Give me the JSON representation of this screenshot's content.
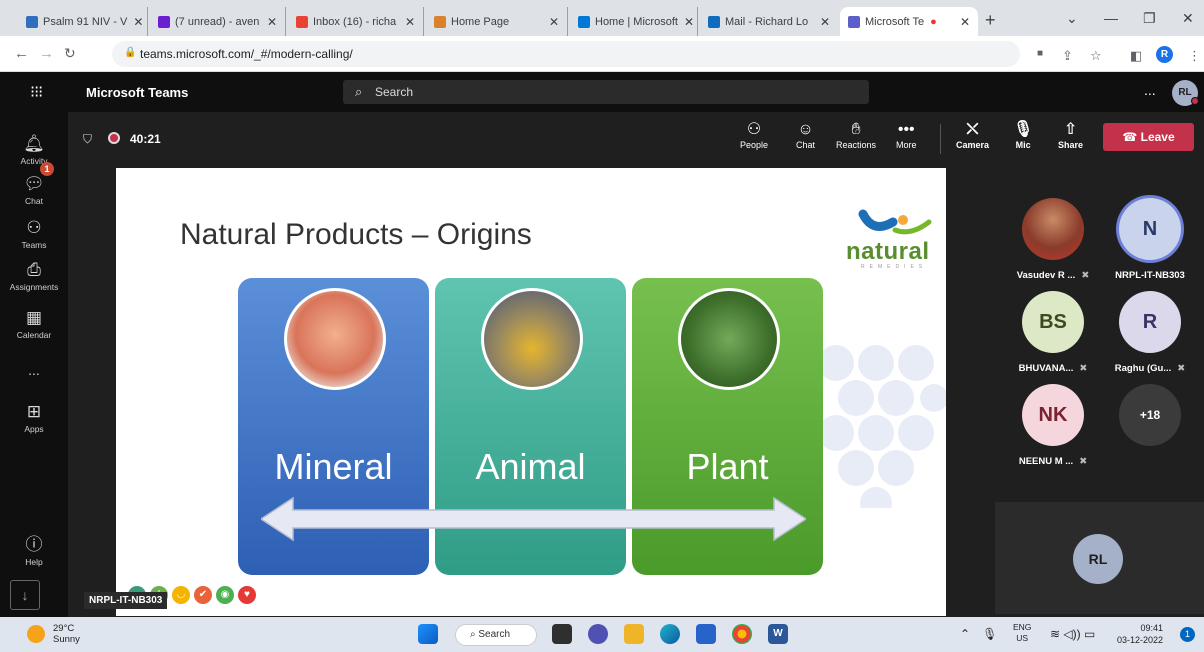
{
  "browser": {
    "tabs": [
      {
        "title": "Psalm 91 NIV - V",
        "icon_color": "#2f6fbd"
      },
      {
        "title": "(7 unread) - aven",
        "icon_color": "#6a1fd0"
      },
      {
        "title": "Inbox (16) - richa",
        "icon_color": "#ea4335"
      },
      {
        "title": "Home Page",
        "icon_color": "#d9822b"
      },
      {
        "title": "Home | Microsoft",
        "icon_color": "#0078d4"
      },
      {
        "title": "Mail - Richard Lo",
        "icon_color": "#0f6cbd"
      },
      {
        "title": "Microsoft Te",
        "icon_color": "#5b5fc7",
        "active": true
      }
    ],
    "new_tab": "+",
    "url": "teams.microsoft.com/_#/modern-calling/",
    "profile_initial": "R"
  },
  "teams": {
    "app_name": "Microsoft Teams",
    "search_placeholder": "Search",
    "more": "...",
    "me_initials": "RL",
    "rail": [
      {
        "label": "Activity",
        "icon": "bell-icon"
      },
      {
        "label": "Chat",
        "icon": "chat-icon",
        "badge": "1"
      },
      {
        "label": "Teams",
        "icon": "teams-icon"
      },
      {
        "label": "Assignments",
        "icon": "assignments-icon"
      },
      {
        "label": "Calendar",
        "icon": "calendar-icon"
      },
      {
        "label": "...",
        "icon": "more-icon"
      },
      {
        "label": "Apps",
        "icon": "apps-icon"
      },
      {
        "label": "Help",
        "icon": "help-icon"
      }
    ],
    "meeting": {
      "timer": "40:21",
      "controls": [
        "People",
        "Chat",
        "Reactions",
        "More",
        "Camera",
        "Mic",
        "Share"
      ],
      "leave_label": "Leave"
    },
    "slide": {
      "title": "Natural Products – Origins",
      "logo_text": "natural",
      "logo_sub": "REMEDIES",
      "pillars": [
        "Mineral",
        "Animal",
        "Plant"
      ]
    },
    "speaker_label": "NRPL-IT-NB303",
    "participants": [
      {
        "name": "Vasudev R ...",
        "initials": "",
        "photo": true,
        "muted": true
      },
      {
        "name": "NRPL-IT-NB303",
        "initials": "N",
        "muted": false
      },
      {
        "name": "BHUVANA...",
        "initials": "BS",
        "muted": true
      },
      {
        "name": "Raghu (Gu...",
        "initials": "R",
        "muted": true
      },
      {
        "name": "NEENU M ...",
        "initials": "NK",
        "muted": true
      },
      {
        "name": "",
        "initials": "+18",
        "muted": false
      }
    ],
    "self_initials": "RL"
  },
  "taskbar": {
    "temperature": "29°C",
    "weather": "Sunny",
    "search_label": "Search",
    "lang_line1": "ENG",
    "lang_line2": "US",
    "time": "09:41",
    "date": "03-12-2022",
    "notifications": "1"
  }
}
